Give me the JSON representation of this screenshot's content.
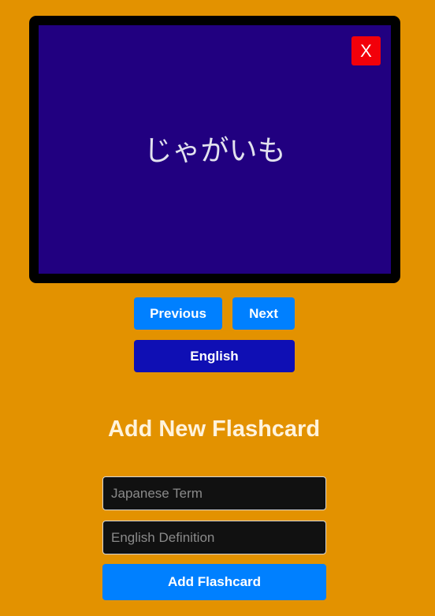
{
  "flashcard": {
    "term": "じゃがいも",
    "close_label": "X"
  },
  "controls": {
    "previous_label": "Previous",
    "next_label": "Next",
    "language_toggle_label": "English"
  },
  "form": {
    "title": "Add New Flashcard",
    "term_placeholder": "Japanese Term",
    "definition_placeholder": "English Definition",
    "term_value": "",
    "definition_value": "",
    "submit_label": "Add Flashcard"
  },
  "colors": {
    "background": "#e39200",
    "card_border": "#000000",
    "card_face": "#210080",
    "close_button": "#f2000a",
    "primary_button": "#0080ff",
    "language_button": "#0f0fb4",
    "input_background": "#111111"
  }
}
